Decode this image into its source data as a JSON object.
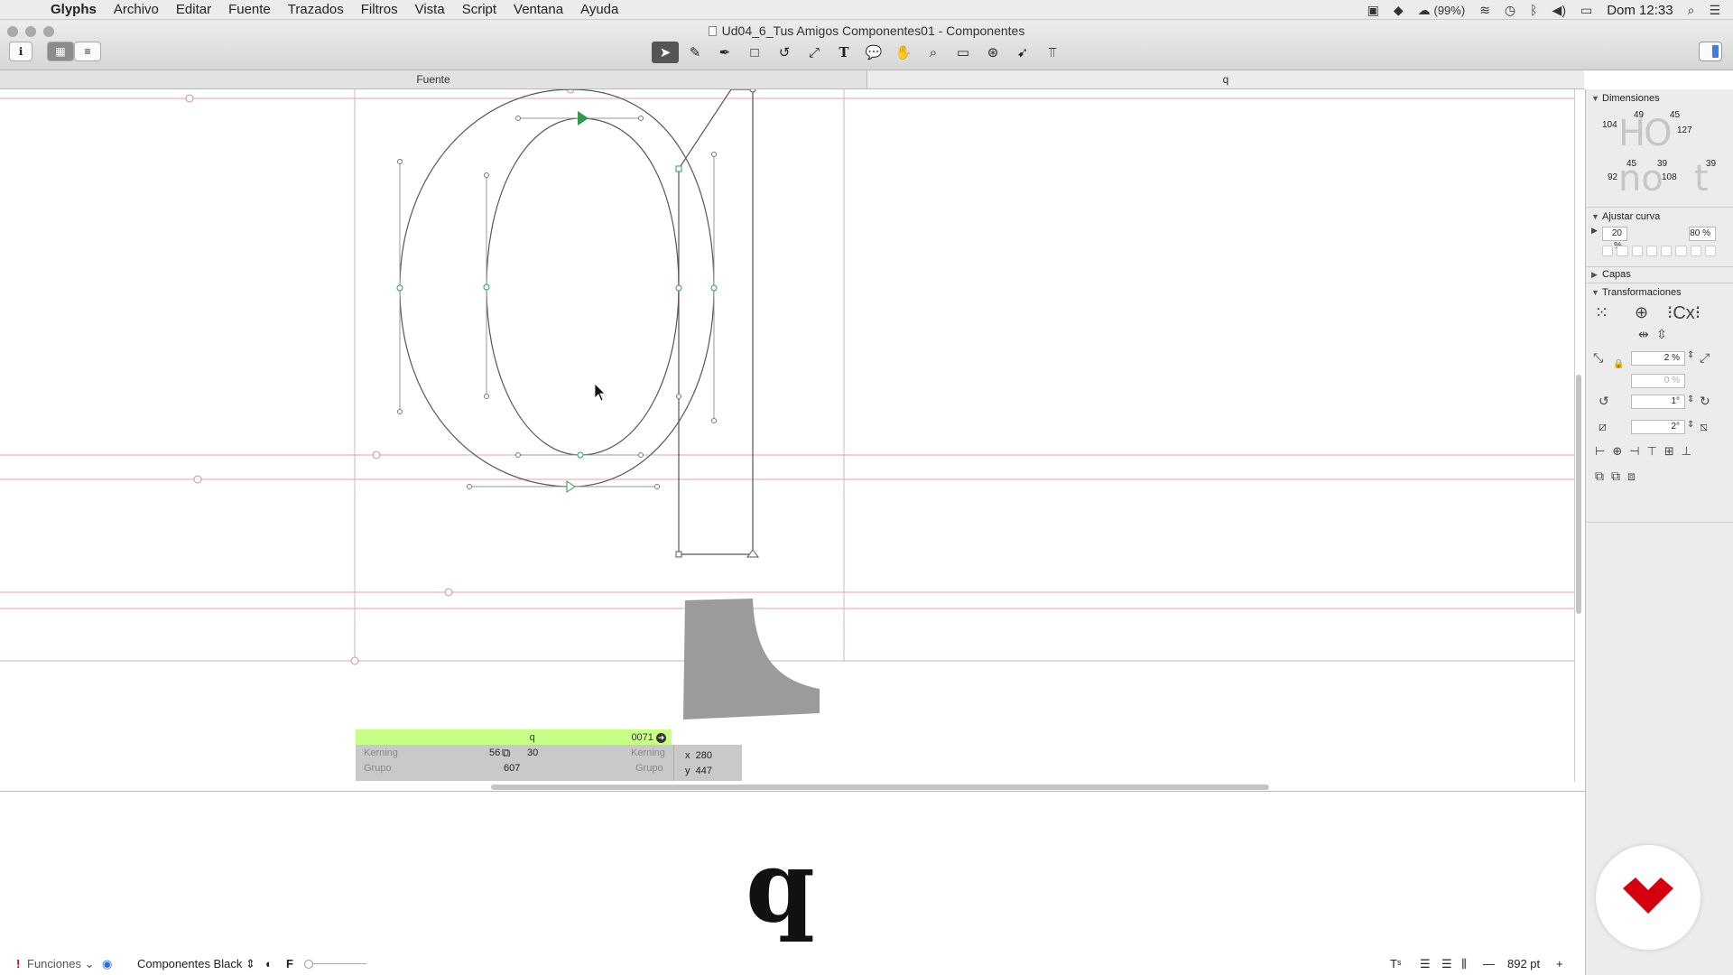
{
  "menubar": {
    "app": "Glyphs",
    "items": [
      "Archivo",
      "Editar",
      "Fuente",
      "Trazados",
      "Filtros",
      "Vista",
      "Script",
      "Ventana",
      "Ayuda"
    ],
    "battery_cloud": "(99%)",
    "clock": "Dom 12:33"
  },
  "window": {
    "title": "Ud04_6_Tus Amigos Componentes01 - Componentes"
  },
  "tabs": {
    "font": "Fuente",
    "glyph": "q"
  },
  "tools": [
    "select-tool",
    "draw-tool",
    "pen-tool",
    "rectangle-tool",
    "rotate-tool",
    "scale-tool",
    "text-tool",
    "annotation-tool",
    "hand-tool",
    "zoom-tool",
    "measure-tool",
    "components-tool",
    "select-all-layers-tool",
    "text-direction-tool"
  ],
  "infobox": {
    "glyph_name": "q",
    "unicode": "0071",
    "kerning_label": "Kerning",
    "group_label": "Grupo",
    "lsb": "56",
    "rsb": "30",
    "width": "607",
    "kerning_label_right": "Kerning",
    "group_label_right": "Grupo",
    "x_label": "x",
    "x_value": "280",
    "y_label": "y",
    "y_value": "447"
  },
  "preview": {
    "glyph": "q"
  },
  "statusbar": {
    "features": "Funciones",
    "master": "Componentes Black",
    "f_label": "F",
    "zoom": "892 pt"
  },
  "palette": {
    "dimensions": {
      "title": "Dimensiones",
      "v104": "104",
      "v49": "49",
      "v45a": "45",
      "v127": "127",
      "v45b": "45",
      "v39a": "39",
      "v39b": "39",
      "v92": "92",
      "v108": "108",
      "ho": "HO",
      "no": "no",
      "t": "t"
    },
    "curve": {
      "title": "Ajustar curva",
      "left": "20 %",
      "right": "80 %"
    },
    "layers": {
      "title": "Capas"
    },
    "transform": {
      "title": "Transformaciones",
      "scale": "2 %",
      "scale2": "0 %",
      "rotate": "1°",
      "slant": "2°"
    }
  },
  "colors": {
    "infobox_head": "#c7ff87",
    "metric_line": "#e08080",
    "node_green": "#2e9a53"
  }
}
